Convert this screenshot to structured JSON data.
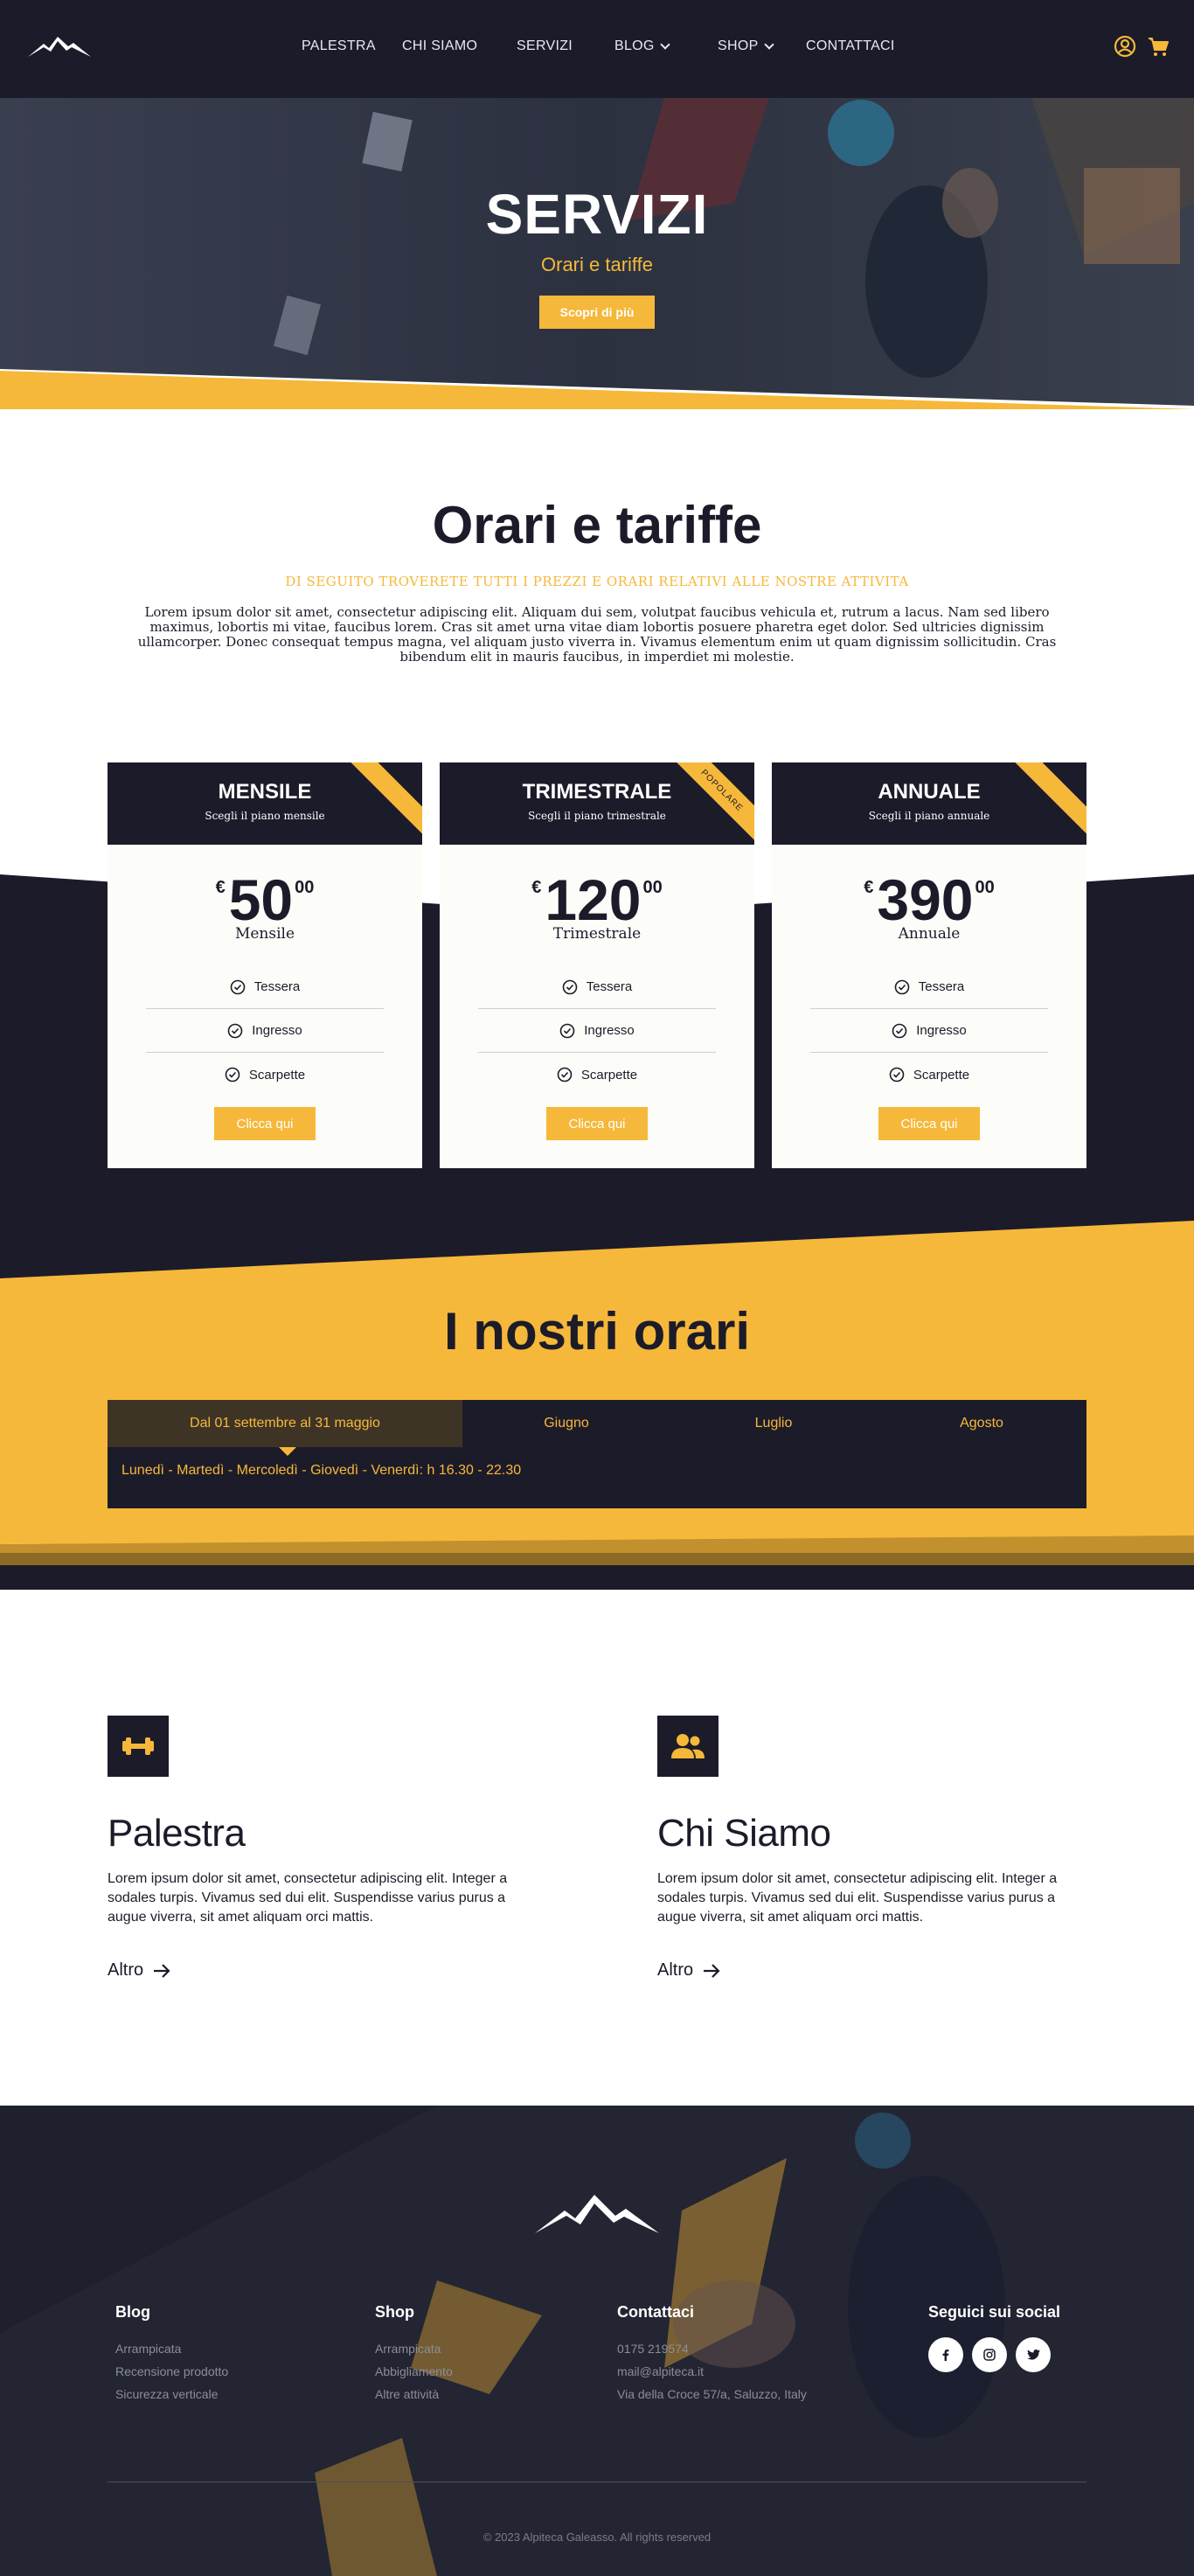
{
  "colors": {
    "dark": "#1c1b29",
    "accent": "#f6b83a",
    "light": "#fcfdf8"
  },
  "header": {
    "nav": [
      {
        "label": "PALESTRA",
        "dropdown": false
      },
      {
        "label": "CHI SIAMO",
        "dropdown": false
      },
      {
        "label": "SERVIZI",
        "dropdown": false
      },
      {
        "label": "BLOG",
        "dropdown": true
      },
      {
        "label": "SHOP",
        "dropdown": true
      },
      {
        "label": "CONTATTACI",
        "dropdown": false
      }
    ],
    "icons": [
      "user-icon",
      "cart-icon"
    ]
  },
  "hero": {
    "title": "SERVIZI",
    "subtitle": "Orari e tariffe",
    "button": "Scopri di più"
  },
  "pricing": {
    "title": "Orari e tariffe",
    "subtitle": "DI SEGUITO TROVERETE TUTTI I PREZZI E ORARI RELATIVI ALLE NOSTRE ATTIVITA",
    "description": "Lorem ipsum dolor sit amet, consectetur adipiscing elit. Aliquam dui sem, volutpat faucibus vehicula et, rutrum a lacus. Nam sed libero maximus, lobortis mi vitae, faucibus lorem. Cras sit amet urna vitae diam lobortis posuere pharetra eget dolor. Sed ultricies dignissim ullamcorper. Donec consequat tempus magna, vel aliquam justo viverra in. Vivamus elementum enim ut quam dignissim sollicitudin. Cras bibendum elit in mauris faucibus, in imperdiet mi molestie.",
    "plans": [
      {
        "name": "MENSILE",
        "sub": "Scegli il piano mensile",
        "currency": "€",
        "amount": "50",
        "decimals": "00",
        "period": "Mensile",
        "ribbon": "",
        "features": [
          "Tessera",
          "Ingresso",
          "Scarpette"
        ],
        "button": "Clicca qui"
      },
      {
        "name": "TRIMESTRALE",
        "sub": "Scegli il piano trimestrale",
        "currency": "€",
        "amount": "120",
        "decimals": "00",
        "period": "Trimestrale",
        "ribbon": "POPOLARE",
        "features": [
          "Tessera",
          "Ingresso",
          "Scarpette"
        ],
        "button": "Clicca qui"
      },
      {
        "name": "ANNUALE",
        "sub": "Scegli il piano annuale",
        "currency": "€",
        "amount": "390",
        "decimals": "00",
        "period": "Annuale",
        "ribbon": "",
        "features": [
          "Tessera",
          "Ingresso",
          "Scarpette"
        ],
        "button": "Clicca qui"
      }
    ]
  },
  "schedule": {
    "title": "I nostri orari",
    "tabs": [
      "Dal 01 settembre al 31 maggio",
      "Giugno",
      "Luglio",
      "Agosto"
    ],
    "active_tab": 0,
    "content": "Lunedì - Martedì - Mercoledì - Giovedì - Venerdì: h 16.30 - 22.30"
  },
  "features": [
    {
      "icon": "dumbbell-icon",
      "title": "Palestra",
      "text": "Lorem ipsum dolor sit amet, consectetur adipiscing elit. Integer a sodales turpis. Vivamus sed dui elit. Suspendisse varius purus a augue viverra, sit amet aliquam orci mattis.",
      "link": "Altro"
    },
    {
      "icon": "users-icon",
      "title": "Chi Siamo",
      "text": "Lorem ipsum dolor sit amet, consectetur adipiscing elit. Integer a sodales turpis. Vivamus sed dui elit. Suspendisse varius purus a augue viverra, sit amet aliquam orci mattis.",
      "link": "Altro"
    }
  ],
  "footer": {
    "columns": [
      {
        "title": "Blog",
        "links": [
          "Arrampicata",
          "Recensione prodotto",
          "Sicurezza verticale"
        ]
      },
      {
        "title": "Shop",
        "links": [
          "Arrampicata",
          "Abbigliamento",
          "Altre attività"
        ]
      },
      {
        "title": "Contattaci",
        "links": [
          "0175 219574",
          "mail@alpiteca.it",
          "Via della Croce 57/a, Saluzzo, Italy"
        ]
      }
    ],
    "social_title": "Seguici sui social",
    "social": [
      "facebook-icon",
      "instagram-icon",
      "twitter-icon"
    ],
    "copyright": "© 2023 Alpiteca Galeasso. All rights reserved"
  }
}
